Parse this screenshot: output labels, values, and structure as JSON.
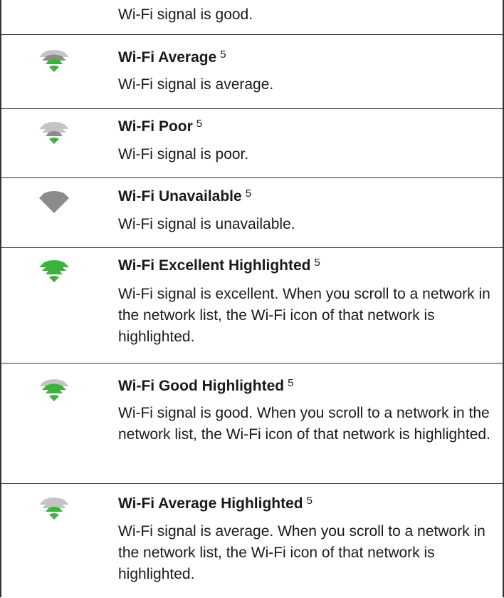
{
  "colors": {
    "green": "#3db33d",
    "grey": "#8c8c8c",
    "light_grey": "#c4c4c4"
  },
  "rows": [
    {
      "icon": "wifi-good-icon",
      "title": "",
      "note": "",
      "desc": "Wi-Fi signal is good."
    },
    {
      "icon": "wifi-average-icon",
      "title": "Wi-Fi Average",
      "note": "5",
      "desc": "Wi-Fi signal is average."
    },
    {
      "icon": "wifi-poor-icon",
      "title": "Wi-Fi Poor",
      "note": "5",
      "desc": "Wi-Fi signal is poor."
    },
    {
      "icon": "wifi-unavailable-icon",
      "title": "Wi-Fi Unavailable",
      "note": "5",
      "desc": "Wi-Fi signal is unavailable."
    },
    {
      "icon": "wifi-excellent-highlighted-icon",
      "title": "Wi-Fi Excellent Highlighted",
      "note": "5",
      "desc": "Wi-Fi signal is excellent. When you scroll to a network in the network list, the Wi-Fi icon of that network is highlighted."
    },
    {
      "icon": "wifi-good-highlighted-icon",
      "title": "Wi-Fi Good Highlighted",
      "note": "5",
      "desc": "Wi-Fi signal is good. When you scroll to a network in the network list, the Wi-Fi icon of that network is highlighted."
    },
    {
      "icon": "wifi-average-highlighted-icon",
      "title": "Wi-Fi Average Highlighted",
      "note": "5",
      "desc": "Wi-Fi signal is average. When you scroll to a network in the network list, the Wi-Fi icon of that network is highlighted."
    }
  ]
}
